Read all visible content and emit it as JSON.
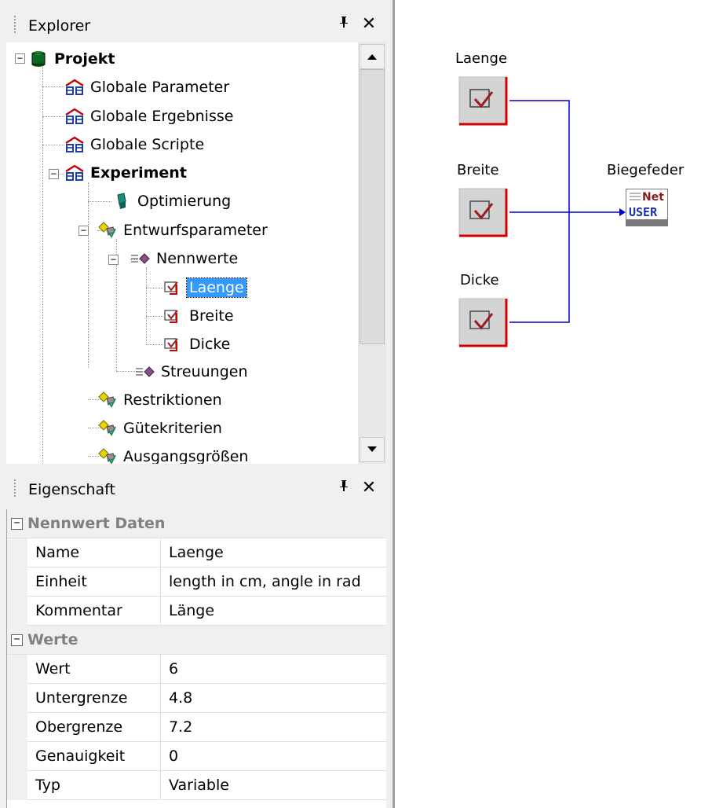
{
  "explorer": {
    "title": "Explorer",
    "pin_glyph": "ᵽ",
    "close_glyph": "✕",
    "tree": [
      {
        "label": "Projekt",
        "icon": "database-icon"
      },
      {
        "label": "Globale Parameter",
        "icon": "folder-group-icon"
      },
      {
        "label": "Globale Ergebnisse",
        "icon": "folder-group-icon"
      },
      {
        "label": "Globale Scripte",
        "icon": "folder-group-icon"
      },
      {
        "label": "Experiment",
        "icon": "folder-group-icon"
      },
      {
        "label": "Optimierung",
        "icon": "cube-icon"
      },
      {
        "label": "Entwurfsparameter",
        "icon": "parameter-set-icon"
      },
      {
        "label": "Nennwerte",
        "icon": "nominal-values-icon"
      },
      {
        "label": "Laenge",
        "icon": "parameter-icon"
      },
      {
        "label": "Breite",
        "icon": "parameter-icon"
      },
      {
        "label": "Dicke",
        "icon": "parameter-icon"
      },
      {
        "label": "Streuungen",
        "icon": "nominal-values-icon"
      },
      {
        "label": "Restriktionen",
        "icon": "parameter-set-icon"
      },
      {
        "label": "Gütekriterien",
        "icon": "parameter-set-icon"
      },
      {
        "label": "Ausgangsgrößen",
        "icon": "parameter-set-icon"
      }
    ],
    "selected": "Laenge",
    "expander_minus": "−"
  },
  "properties": {
    "title": "Eigenschaft",
    "pin_glyph": "ᵽ",
    "close_glyph": "✕",
    "categories": [
      {
        "name": "Nennwert Daten",
        "rows": [
          {
            "name": "Name",
            "value": "Laenge"
          },
          {
            "name": "Einheit",
            "value": "length in cm, angle in rad"
          },
          {
            "name": "Kommentar",
            "value": "Länge"
          }
        ]
      },
      {
        "name": "Werte",
        "rows": [
          {
            "name": "Wert",
            "value": "6"
          },
          {
            "name": "Untergrenze",
            "value": "4.8"
          },
          {
            "name": "Obergrenze",
            "value": "7.2"
          },
          {
            "name": "Genauigkeit",
            "value": "0"
          },
          {
            "name": "Typ",
            "value": "Variable"
          }
        ]
      }
    ],
    "collapse_glyph": "−"
  },
  "diagram": {
    "inputs": [
      "Laenge",
      "Breite",
      "Dicke"
    ],
    "target": {
      "label": "Biegefeder",
      "top_text": "Net",
      "bottom_text": "USER"
    },
    "colors": {
      "wire": "#0000cc",
      "block_red": "#d40000",
      "check": "#9b1c1c"
    }
  }
}
